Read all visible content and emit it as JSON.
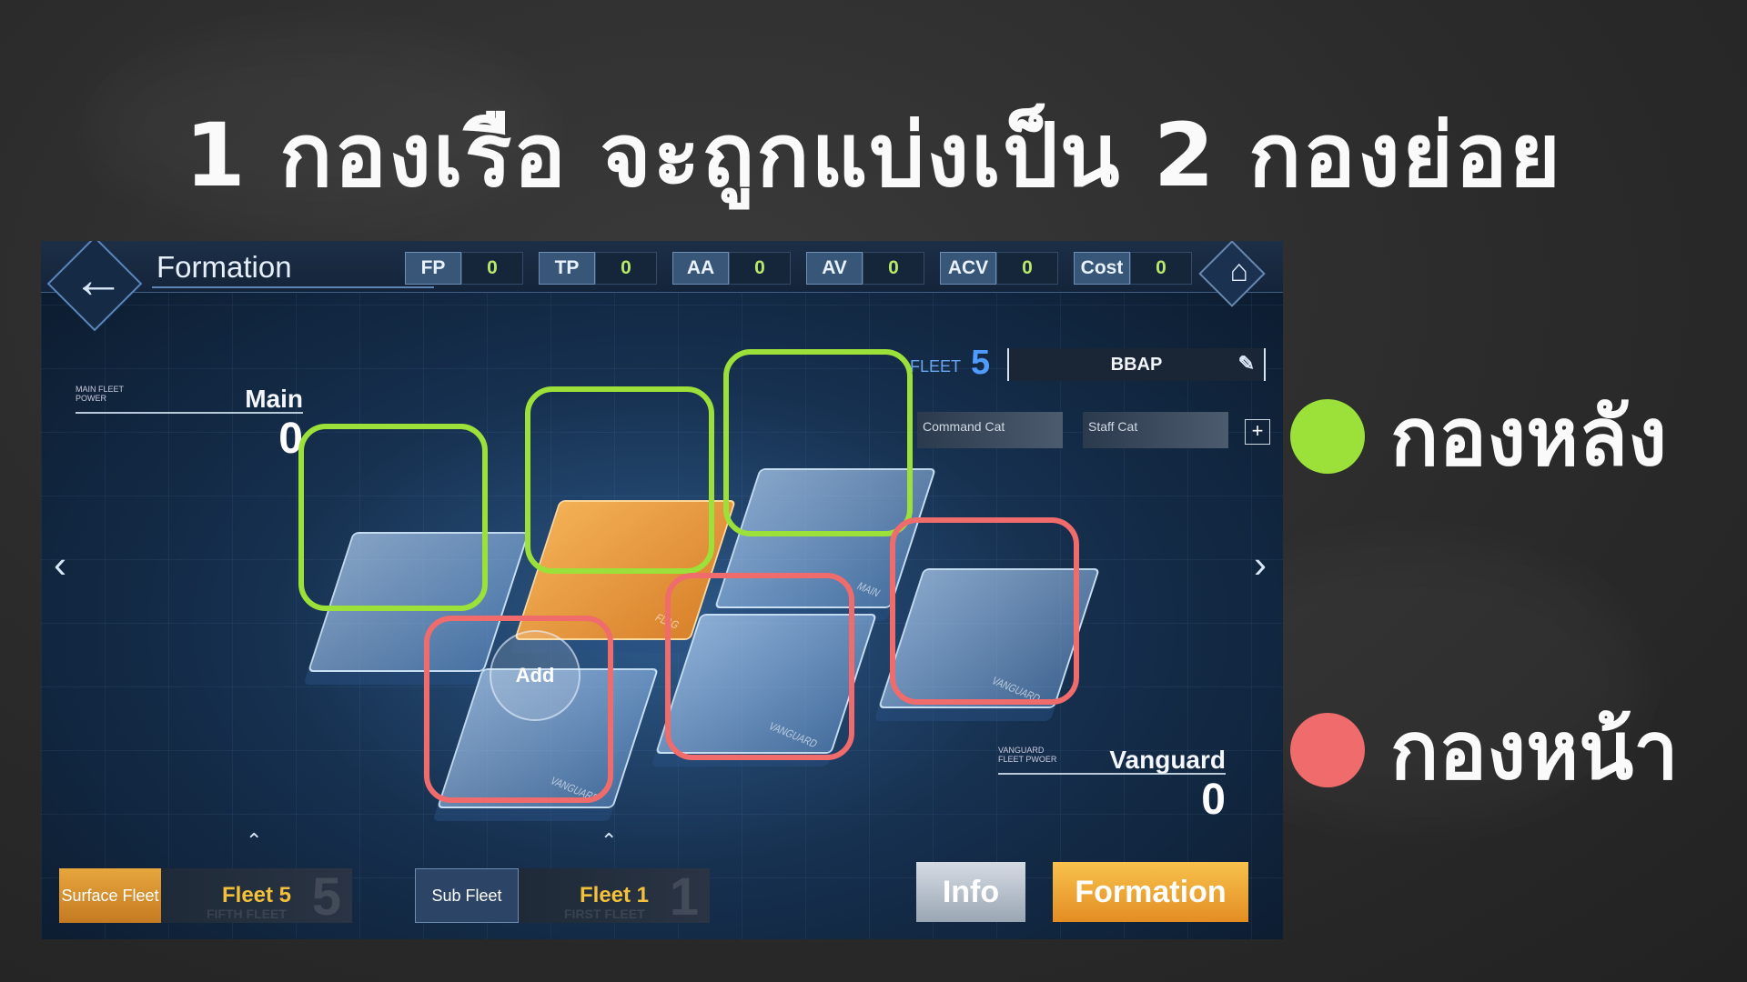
{
  "slide": {
    "title": "1 กองเรือ จะถูกแบ่งเป็น 2 กองย่อย",
    "legend": [
      {
        "label": "กองหลัง",
        "color": "#9be13a"
      },
      {
        "label": "กองหน้า",
        "color": "#f06b6b"
      }
    ]
  },
  "game": {
    "header_title": "Formation",
    "stats": [
      {
        "label": "FP",
        "value": "0"
      },
      {
        "label": "TP",
        "value": "0"
      },
      {
        "label": "AA",
        "value": "0"
      },
      {
        "label": "AV",
        "value": "0"
      },
      {
        "label": "ACV",
        "value": "0"
      },
      {
        "label": "Cost",
        "value": "0"
      }
    ],
    "main_power": {
      "small_label": "MAIN FLEET POWER",
      "name": "Main",
      "value": "0"
    },
    "vanguard_power": {
      "small_label": "VANGUARD FLEET PWOER",
      "name": "Vanguard",
      "value": "0"
    },
    "fleet": {
      "label": "FLEET",
      "number": "5",
      "name": "BBAP"
    },
    "cats": {
      "command": "Command Cat",
      "staff": "Staff Cat"
    },
    "tiles": {
      "flag": "FLAG",
      "main": "MAIN",
      "vanguard": "VANGUARD"
    },
    "add_label": "Add",
    "tabs": [
      {
        "kind": "Surface Fleet",
        "fleet": "Fleet 5",
        "sub": "FIFTH FLEET",
        "num": "5"
      },
      {
        "kind": "Sub Fleet",
        "fleet": "Fleet 1",
        "sub": "FIRST FLEET",
        "num": "1"
      }
    ],
    "info_label": "Info",
    "formation_label": "Formation",
    "icons": {
      "back": "back-arrow-icon",
      "home": "home-icon",
      "edit": "edit-icon",
      "plus": "plus-icon",
      "left": "chevron-left-icon",
      "right": "chevron-right-icon"
    }
  }
}
